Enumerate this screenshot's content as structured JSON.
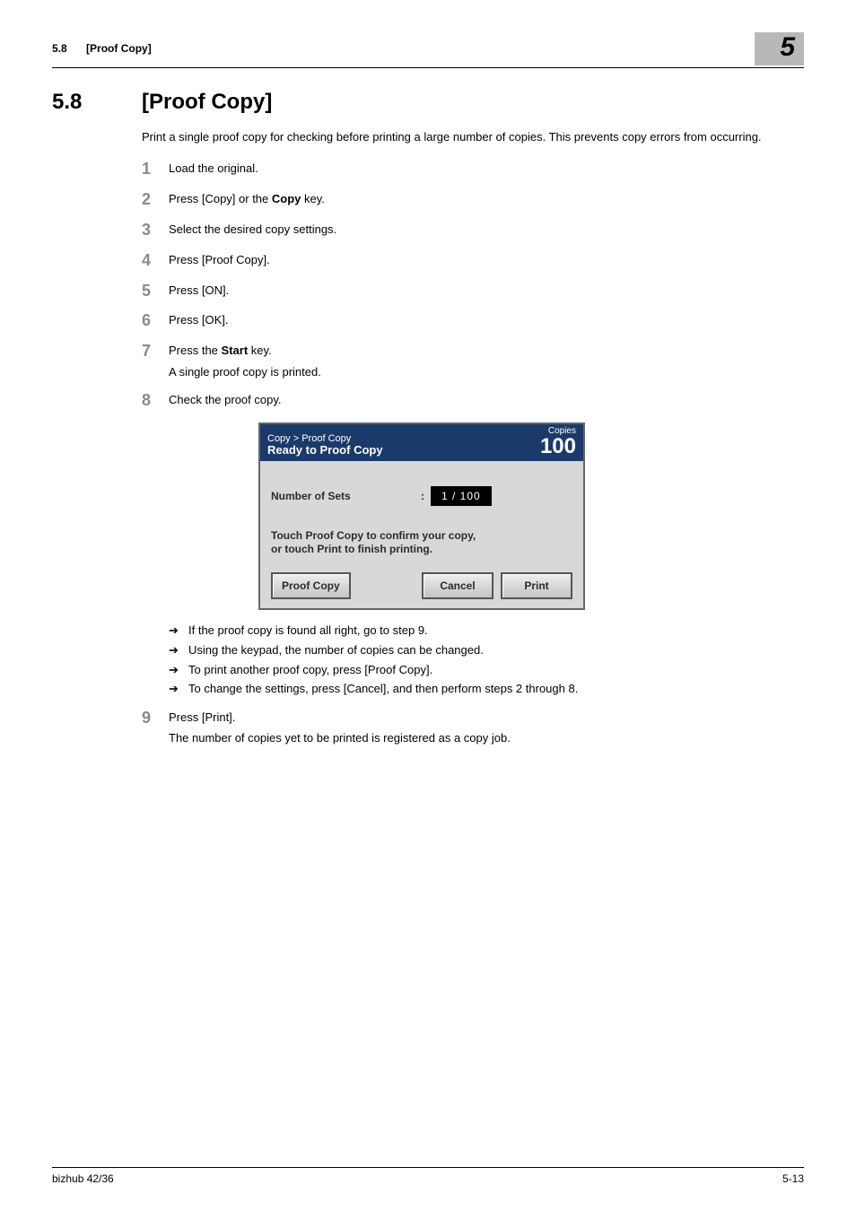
{
  "runhead": {
    "secnum": "5.8",
    "sectitle": "[Proof Copy]",
    "chapnum": "5"
  },
  "heading": {
    "num": "5.8",
    "title": "[Proof Copy]"
  },
  "intro": "Print a single proof copy for checking before printing a large number of copies. This prevents copy errors from occurring.",
  "steps": {
    "s1": "Load the original.",
    "s2_a": "Press [Copy] or the ",
    "s2_b": "Copy",
    "s2_c": " key.",
    "s3": "Select the desired copy settings.",
    "s4": "Press [Proof Copy].",
    "s5": "Press [ON].",
    "s6": "Press [OK].",
    "s7_a": "Press the ",
    "s7_b": "Start",
    "s7_c": " key.",
    "s7_sub": "A single proof copy is printed.",
    "s8": "Check the proof copy.",
    "s9": "Press [Print].",
    "s9_sub": "The number of copies yet to be printed is registered as a copy job."
  },
  "arrows": {
    "a1": "If the proof copy is found all right, go to step 9.",
    "a2": "Using the keypad, the number of copies can be changed.",
    "a3": "To print another proof copy, press [Proof Copy].",
    "a4": "To change the settings, press [Cancel], and then perform steps 2 through 8."
  },
  "panel": {
    "breadcrumb": "Copy > Proof Copy",
    "status": "Ready to Proof Copy",
    "copies_label": "Copies",
    "copies_value": "100",
    "numsets_label": "Number of Sets",
    "numsets_value": "1  /  100",
    "msg_line1": "Touch Proof Copy to confirm your copy,",
    "msg_line2": "or touch Print to finish printing.",
    "btn_proof": "Proof Copy",
    "btn_cancel": "Cancel",
    "btn_print": "Print"
  },
  "footer": {
    "manual": "bizhub 42/36",
    "pagenum": "5-13"
  }
}
